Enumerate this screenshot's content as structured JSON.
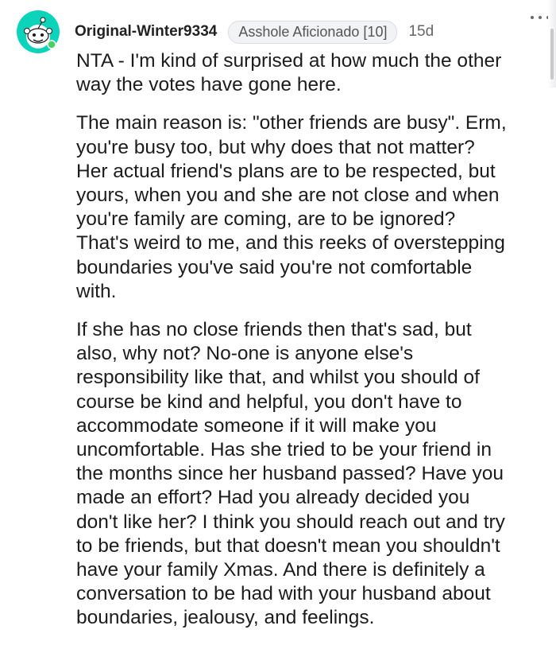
{
  "comment": {
    "username": "Original-Winter9334",
    "flair": "Asshole Aficionado [10]",
    "age": "15d",
    "more_label": "•••",
    "avatar_icon": "snoo-avatar-icon",
    "paragraphs": [
      "NTA - I'm kind of surprised at how much the other\nway the votes have gone here.",
      "The main reason is: \"other friends are busy\". Erm,\nyou're busy too, but why does that not matter?\nHer actual friend's plans are to be respected, but\nyours, when you and she are not close and when\nyou're family are coming, are to be ignored?\nThat's weird to me, and this reeks of overstepping\nboundaries you've said you're not comfortable\nwith.",
      "If she has no close friends then that's sad, but\nalso, why not? No-one is anyone else's\nresponsibility like that, and whilst you should of\ncourse be kind and helpful, you don't have to\naccommodate someone if it will make you\nuncomfortable. Has she tried to be your friend in\nthe months since her husband passed? Have you\nmade an effort? Had you already decided you\ndon't like her? I think you should reach out and try\nto be friends, but that doesn't mean you shouldn't\nhave your family Xmas. And there is definitely a\nconversation to be had with your husband about\nboundaries, jealousy, and feelings."
    ]
  },
  "colors": {
    "text": "#1c1c1c",
    "username": "#222222",
    "meta": "#666666",
    "flair_bg": "#f2f3f5",
    "avatar_bg": "#0dd3bb"
  }
}
